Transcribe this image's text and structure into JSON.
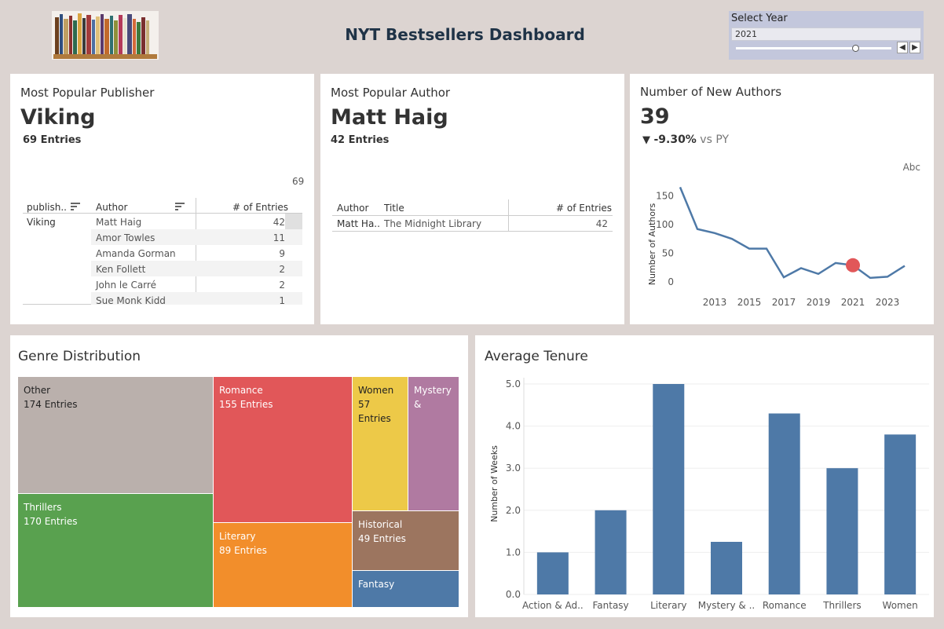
{
  "header": {
    "title": "NYT Bestsellers Dashboard",
    "logo": "bookshelf-logo"
  },
  "year_filter": {
    "label": "Select Year",
    "value": "2021",
    "prev_icon": "chevron-left-icon",
    "next_icon": "chevron-right-icon",
    "slider_level": 0.8
  },
  "publisher": {
    "title": "Most Popular Publisher",
    "name": "Viking",
    "entries": "69 Entries",
    "axis_max": "69",
    "columns": [
      "publish..",
      "Author",
      "# of Entries"
    ],
    "row_group": "Viking",
    "rows": [
      {
        "author": "Matt Haig",
        "count": "42"
      },
      {
        "author": "Amor Towles",
        "count": "11"
      },
      {
        "author": "Amanda Gorman",
        "count": "9"
      },
      {
        "author": "Ken Follett",
        "count": "2"
      },
      {
        "author": "John le Carré",
        "count": "2"
      },
      {
        "author": "Sue Monk Kidd",
        "count": "1"
      }
    ]
  },
  "author": {
    "title": "Most Popular Author",
    "name": "Matt Haig",
    "entries": "42 Entries",
    "columns": [
      "Author",
      "Title",
      "# of Entries"
    ],
    "row": {
      "author": "Matt Ha..",
      "title": "The Midnight Library",
      "count": "42"
    }
  },
  "new_authors": {
    "title": "Number of New Authors",
    "value": "39",
    "delta": "-9.30%",
    "delta_suffix": "vs PY",
    "delta_icon": "down-triangle-icon",
    "abc": "Abc",
    "chart_data": {
      "type": "line",
      "ylabel": "Number of Authors",
      "ylim": [
        0,
        160
      ],
      "yticks": [
        "150",
        "100",
        "50",
        "0"
      ],
      "xticks": [
        "2013",
        "2015",
        "2017",
        "2019",
        "2021",
        "2023"
      ],
      "x": [
        2011,
        2012,
        2013,
        2014,
        2015,
        2016,
        2017,
        2018,
        2019,
        2020,
        2021,
        2022,
        2023,
        2024
      ],
      "values": [
        165,
        92,
        85,
        75,
        58,
        58,
        8,
        24,
        14,
        33,
        29,
        7,
        9,
        28
      ],
      "highlight_x": 2021,
      "line_color": "#4e79a7",
      "highlight_color": "#e15759"
    }
  },
  "genre": {
    "title": "Genre Distribution",
    "chart_data": {
      "type": "treemap",
      "items": [
        {
          "name": "Other",
          "label": "174 Entries",
          "value": 174,
          "color": "#bab0ac"
        },
        {
          "name": "Thrillers",
          "label": "170 Entries",
          "value": 170,
          "color": "#59a14f"
        },
        {
          "name": "Romance",
          "label": "155 Entries",
          "value": 155,
          "color": "#e15759"
        },
        {
          "name": "Literary",
          "label": "89 Entries",
          "value": 89,
          "color": "#f28e2b"
        },
        {
          "name": "Women",
          "label": "57 Entries",
          "value": 57,
          "color": "#edc948"
        },
        {
          "name": "Mystery &",
          "label": "",
          "value": 55,
          "color": "#b07aa1"
        },
        {
          "name": "Historical",
          "label": "49 Entries",
          "value": 49,
          "color": "#9c755f"
        },
        {
          "name": "Fantasy",
          "label": "",
          "value": 29,
          "color": "#4e79a7"
        }
      ]
    }
  },
  "tenure": {
    "title": "Average Tenure",
    "chart_data": {
      "type": "bar",
      "ylabel": "Number of Weeks",
      "ylim": [
        0,
        5
      ],
      "yticks": [
        "5.0",
        "4.0",
        "3.0",
        "2.0",
        "1.0",
        "0.0"
      ],
      "categories": [
        "Action & Ad..",
        "Fantasy",
        "Literary",
        "Mystery & ..",
        "Romance",
        "Thrillers",
        "Women"
      ],
      "values": [
        1.0,
        2.0,
        5.0,
        1.25,
        4.3,
        3.0,
        3.8
      ],
      "color": "#4e79a7"
    }
  }
}
